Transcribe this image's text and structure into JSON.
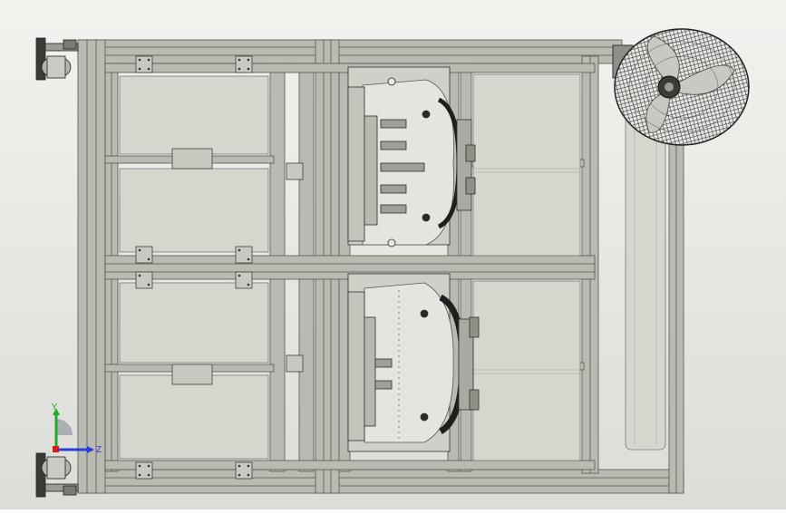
{
  "view": {
    "background_top": "#f2f2ef",
    "background_bottom": "#dcdcd8",
    "frame_color": "#b9bab2",
    "frame_dark": "#55574f",
    "panel_color": "#d6d6ce",
    "metal_color": "#c8c9c1"
  },
  "triad": {
    "y_label": "Y",
    "z_label": "Z",
    "y_color": "#22a82a",
    "z_color": "#2a3ee0",
    "x_color": "#d81c1c"
  }
}
